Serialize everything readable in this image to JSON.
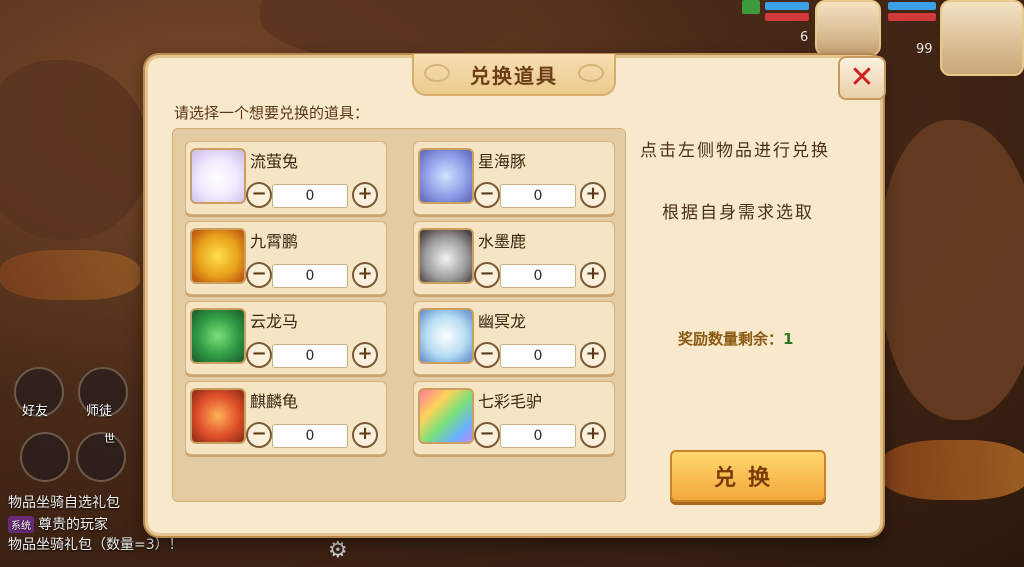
{
  "hud": {
    "level_left": "6",
    "level_right": "99"
  },
  "side": {
    "friends": "好友",
    "mentor": "师徒",
    "world": "世"
  },
  "chat": {
    "line1": "物品坐骑自选礼包",
    "tag": "系统",
    "line2": "尊贵的玩家",
    "line3": "物品坐骑礼包（数量=3）！"
  },
  "dialog": {
    "title": "兑换道具",
    "prompt": "请选择一个想要兑换的道具：",
    "items": [
      {
        "name": "流萤兔",
        "qty": "0",
        "icon": "white-rabbit-icon"
      },
      {
        "name": "星海豚",
        "qty": "0",
        "icon": "dolphin-icon"
      },
      {
        "name": "九霄鹏",
        "qty": "0",
        "icon": "phoenix-icon"
      },
      {
        "name": "水墨鹿",
        "qty": "0",
        "icon": "ink-deer-icon"
      },
      {
        "name": "云龙马",
        "qty": "0",
        "icon": "green-dragon-horse-icon"
      },
      {
        "name": "幽冥龙",
        "qty": "0",
        "icon": "ghost-dragon-icon"
      },
      {
        "name": "麒麟龟",
        "qty": "0",
        "icon": "qilin-turtle-icon"
      },
      {
        "name": "七彩毛驴",
        "qty": "0",
        "icon": "rainbow-donkey-icon"
      }
    ],
    "hint1": "点击左侧物品进行兑换",
    "hint2": "根据自身需求选取",
    "remain_label": "奖励数量剩余：",
    "remain_value": "1",
    "exchange_label": "兑换",
    "minus": "−",
    "plus": "+",
    "close": "✕"
  },
  "colors": {
    "accent": "#f3a73a",
    "title": "#6b3d14",
    "close": "#d21f1f"
  }
}
